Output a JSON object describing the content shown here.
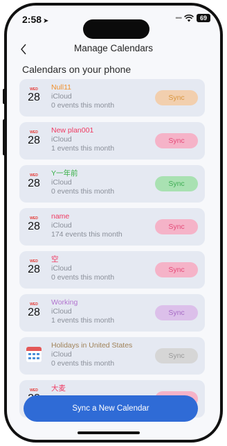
{
  "status": {
    "time": "2:58",
    "battery": "69"
  },
  "header": {
    "title": "Manage Calendars"
  },
  "section": {
    "title": "Calendars on your phone"
  },
  "calendars": [
    {
      "icon": "calendar-date-icon",
      "weekday": "WED",
      "day": "28",
      "name": "Null11",
      "name_color": "#f0912f",
      "source": "iCloud",
      "events": "0 events this month",
      "sync_label": "Sync",
      "sync_bg": "#f2cfae",
      "sync_fg": "#d9963f"
    },
    {
      "icon": "calendar-date-icon",
      "weekday": "WED",
      "day": "28",
      "name": "New plan001",
      "name_color": "#ef3a62",
      "source": "iCloud",
      "events": "1 events this month",
      "sync_label": "Sync",
      "sync_bg": "#f5b3c8",
      "sync_fg": "#e54b79"
    },
    {
      "icon": "calendar-date-icon",
      "weekday": "WED",
      "day": "28",
      "name": "Y一年前",
      "name_color": "#3bb14a",
      "source": "iCloud",
      "events": "0 events this month",
      "sync_label": "Sync",
      "sync_bg": "#a9e1b2",
      "sync_fg": "#3fae54"
    },
    {
      "icon": "calendar-date-icon",
      "weekday": "WED",
      "day": "28",
      "name": "name",
      "name_color": "#ef3a62",
      "source": "iCloud",
      "events": "174 events this month",
      "sync_label": "Sync",
      "sync_bg": "#f5b3c8",
      "sync_fg": "#e54b79"
    },
    {
      "icon": "calendar-date-icon",
      "weekday": "WED",
      "day": "28",
      "name": "空",
      "name_color": "#ef3a62",
      "source": "iCloud",
      "events": "0 events this month",
      "sync_label": "Sync",
      "sync_bg": "#f5b3c8",
      "sync_fg": "#e54b79"
    },
    {
      "icon": "calendar-date-icon",
      "weekday": "WED",
      "day": "28",
      "name": "Working",
      "name_color": "#b274cf",
      "source": "iCloud",
      "events": "1 events this month",
      "sync_label": "Sync",
      "sync_bg": "#dcc0ea",
      "sync_fg": "#a76cc6"
    },
    {
      "icon": "holiday-calendar-icon",
      "weekday": "",
      "day": "",
      "name": "Holidays in United States",
      "name_color": "#a08258",
      "source": "iCloud",
      "events": "0 events this month",
      "sync_label": "Sync",
      "sync_bg": "#d6d6d6",
      "sync_fg": "#9a9a9a"
    },
    {
      "icon": "calendar-date-icon",
      "weekday": "WED",
      "day": "28",
      "name": "大麦",
      "name_color": "#ef3a62",
      "source": "",
      "events": "",
      "sync_label": "",
      "sync_bg": "#f5b3c8",
      "sync_fg": "#e54b79"
    }
  ],
  "cta": {
    "label": "Sync a New Calendar"
  }
}
